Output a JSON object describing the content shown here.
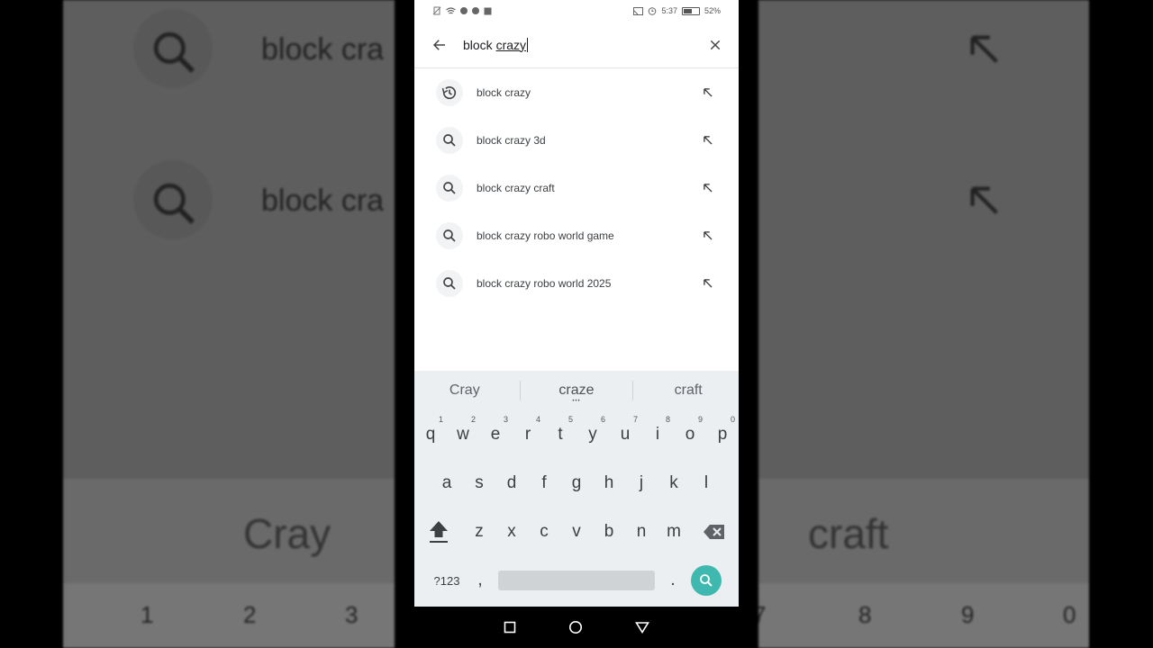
{
  "background": {
    "big_query_fragment_1": "block cra",
    "big_query_fragment_2": "block cra",
    "big_kb_left": "Cray",
    "big_kb_right": "craft",
    "big_nums_left": [
      "1",
      "2",
      "3"
    ],
    "big_nums_right": [
      "7",
      "8",
      "9",
      "0"
    ]
  },
  "status_bar": {
    "time": "5:37",
    "battery": "52%"
  },
  "search": {
    "query_prefix": "block ",
    "query_word": "crazy"
  },
  "suggestions": [
    {
      "label": "block crazy",
      "icon": "history-icon"
    },
    {
      "label": "block crazy 3d",
      "icon": "search-icon"
    },
    {
      "label": "block crazy craft",
      "icon": "search-icon"
    },
    {
      "label": "block crazy robo world game",
      "icon": "search-icon"
    },
    {
      "label": "block crazy robo world 2025",
      "icon": "search-icon"
    }
  ],
  "keyboard": {
    "word_suggestions": [
      "Cray",
      "craze",
      "craft"
    ],
    "row1": [
      {
        "k": "q",
        "n": "1"
      },
      {
        "k": "w",
        "n": "2"
      },
      {
        "k": "e",
        "n": "3"
      },
      {
        "k": "r",
        "n": "4"
      },
      {
        "k": "t",
        "n": "5"
      },
      {
        "k": "y",
        "n": "6"
      },
      {
        "k": "u",
        "n": "7"
      },
      {
        "k": "i",
        "n": "8"
      },
      {
        "k": "o",
        "n": "9"
      },
      {
        "k": "p",
        "n": "0"
      }
    ],
    "row2": [
      "a",
      "s",
      "d",
      "f",
      "g",
      "h",
      "j",
      "k",
      "l"
    ],
    "row3": [
      "z",
      "x",
      "c",
      "v",
      "b",
      "n",
      "m"
    ],
    "symbols_label": "?123",
    "comma": ",",
    "period": "."
  },
  "colors": {
    "search_accent": "#3fb8af",
    "keyboard_bg": "#eceff1"
  }
}
